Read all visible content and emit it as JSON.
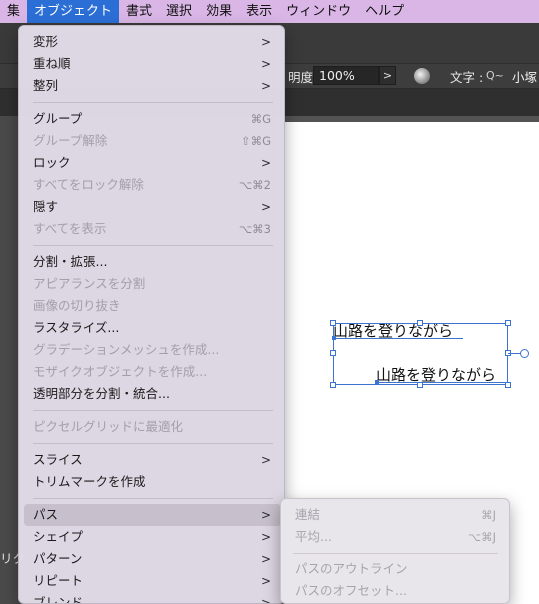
{
  "menubar": {
    "items": [
      "集",
      "オブジェクト",
      "書式",
      "選択",
      "効果",
      "表示",
      "ウィンドウ",
      "ヘルプ"
    ],
    "active_index": 1
  },
  "control_bar": {
    "opacity_label": "明度 :",
    "opacity_value": "100%",
    "arrow": ">",
    "char_label": "文字 :",
    "font_search": "Q~",
    "font_name": "小塚"
  },
  "left_stub": "リク",
  "canvas": {
    "line1": "山路を登りながら",
    "line2": "山路を登りながら",
    "selection_color": "#3b73d1"
  },
  "object_menu": {
    "items": [
      {
        "label": "変形",
        "arrow": ">",
        "shortcut": "",
        "disabled": false
      },
      {
        "label": "重ね順",
        "arrow": ">",
        "shortcut": "",
        "disabled": false
      },
      {
        "label": "整列",
        "arrow": ">",
        "shortcut": "",
        "disabled": false
      },
      {
        "label": "グループ",
        "arrow": "",
        "shortcut": "⌘G",
        "disabled": false
      },
      {
        "label": "グループ解除",
        "arrow": "",
        "shortcut": "⇧⌘G",
        "disabled": true
      },
      {
        "label": "ロック",
        "arrow": ">",
        "shortcut": "",
        "disabled": false
      },
      {
        "label": "すべてをロック解除",
        "arrow": "",
        "shortcut": "⌥⌘2",
        "disabled": true
      },
      {
        "label": "隠す",
        "arrow": ">",
        "shortcut": "",
        "disabled": false
      },
      {
        "label": "すべてを表示",
        "arrow": "",
        "shortcut": "⌥⌘3",
        "disabled": true
      },
      {
        "label": "分割・拡張...",
        "arrow": "",
        "shortcut": "",
        "disabled": false
      },
      {
        "label": "アピアランスを分割",
        "arrow": "",
        "shortcut": "",
        "disabled": true
      },
      {
        "label": "画像の切り抜き",
        "arrow": "",
        "shortcut": "",
        "disabled": true
      },
      {
        "label": "ラスタライズ...",
        "arrow": "",
        "shortcut": "",
        "disabled": false
      },
      {
        "label": "グラデーションメッシュを作成...",
        "arrow": "",
        "shortcut": "",
        "disabled": true
      },
      {
        "label": "モザイクオブジェクトを作成...",
        "arrow": "",
        "shortcut": "",
        "disabled": true
      },
      {
        "label": "透明部分を分割・統合...",
        "arrow": "",
        "shortcut": "",
        "disabled": false
      },
      {
        "label": "ピクセルグリッドに最適化",
        "arrow": "",
        "shortcut": "",
        "disabled": true
      },
      {
        "label": "スライス",
        "arrow": ">",
        "shortcut": "",
        "disabled": false
      },
      {
        "label": "トリムマークを作成",
        "arrow": "",
        "shortcut": "",
        "disabled": false
      },
      {
        "label": "パス",
        "arrow": ">",
        "shortcut": "",
        "disabled": false,
        "highlighted": true
      },
      {
        "label": "シェイプ",
        "arrow": ">",
        "shortcut": "",
        "disabled": false
      },
      {
        "label": "パターン",
        "arrow": ">",
        "shortcut": "",
        "disabled": false
      },
      {
        "label": "リピート",
        "arrow": ">",
        "shortcut": "",
        "disabled": false
      },
      {
        "label": "ブレンド",
        "arrow": ">",
        "shortcut": "",
        "disabled": false
      }
    ]
  },
  "path_submenu": {
    "items": [
      {
        "label": "連結",
        "shortcut": "⌘J",
        "disabled": true
      },
      {
        "label": "平均...",
        "shortcut": "⌥⌘J",
        "disabled": true
      },
      {
        "label": "パスのアウトライン",
        "shortcut": "",
        "disabled": true
      },
      {
        "label": "パスのオフセット...",
        "shortcut": "",
        "disabled": true
      }
    ]
  }
}
